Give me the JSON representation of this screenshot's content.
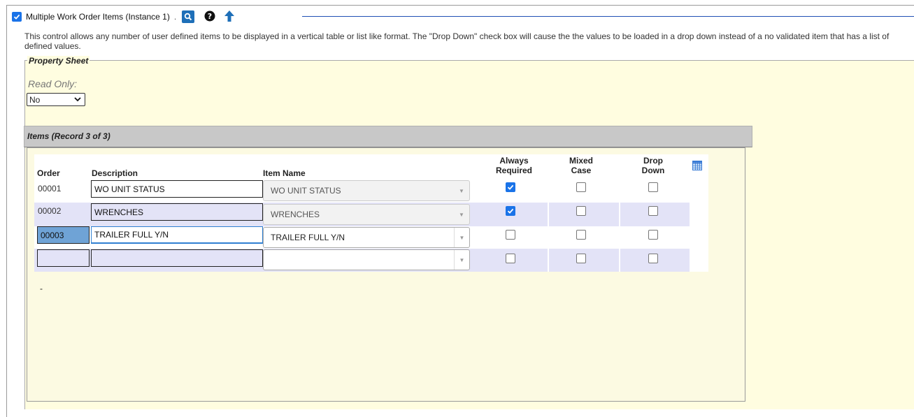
{
  "header": {
    "enabled_checked": true,
    "title": "Multiple Work Order Items (Instance 1)",
    "dot": ".",
    "icons": [
      "magnifier-icon",
      "help-circle-icon",
      "arrow-up-icon"
    ]
  },
  "description": "This control allows any number of user defined items to be displayed in a vertical table or list like format. The \"Drop Down\" check box will cause the the values to be loaded in a drop down instead of a no validated item that has a list of defined values.",
  "property_sheet": {
    "legend": "Property Sheet",
    "read_only_label": "Read Only:",
    "read_only_value": "No"
  },
  "items": {
    "bar_label": "Items (Record 3 of 3)",
    "columns": {
      "order": "Order",
      "description": "Description",
      "item_name": "Item Name",
      "always_required": [
        "Always",
        "Required"
      ],
      "mixed_case": [
        "Mixed",
        "Case"
      ],
      "drop_down": [
        "Drop",
        "Down"
      ]
    },
    "rows": [
      {
        "order": "00001",
        "description": "WO UNIT STATUS",
        "item_name": "WO UNIT STATUS",
        "always_required": true,
        "mixed_case": false,
        "drop_down": false
      },
      {
        "order": "00002",
        "description": "WRENCHES",
        "item_name": "WRENCHES",
        "always_required": true,
        "mixed_case": false,
        "drop_down": false
      },
      {
        "order": "00003",
        "description": "TRAILER FULL Y/N",
        "item_name": "TRAILER FULL Y/N",
        "always_required": false,
        "mixed_case": false,
        "drop_down": false
      },
      {
        "order": "",
        "description": "",
        "item_name": "",
        "always_required": false,
        "mixed_case": false,
        "drop_down": false
      }
    ],
    "footer_dash": "-"
  },
  "colors": {
    "accent": "#1a73e8",
    "panel_bg": "#fffde0",
    "band": "#e3e3f7",
    "selected_order": "#6fa3d6",
    "header_line": "#1f4fb5"
  }
}
